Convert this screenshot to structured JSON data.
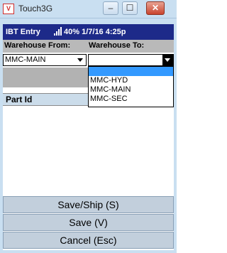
{
  "window": {
    "title": "Touch3G",
    "icon_text": "V",
    "minimize_symbol": "–",
    "maximize_symbol": "☐",
    "close_symbol": "✕"
  },
  "status": {
    "screen_name": "IBT Entry",
    "signal_icon": "signal-bars-icon",
    "battery": "40%",
    "date": "1/7/16",
    "time": "4:25p"
  },
  "form": {
    "warehouse_from_label": "Warehouse From:",
    "warehouse_to_label": "Warehouse To:",
    "warehouse_from_value": "MMC-MAIN",
    "warehouse_to_value": "",
    "warehouse_to_options": [
      "",
      "MMC-HYD",
      "MMC-MAIN",
      "MMC-SEC"
    ],
    "grid_header": "Part Id"
  },
  "buttons": {
    "ship": "Save/Ship (S)",
    "save": "Save (V)",
    "cancel": "Cancel (Esc)"
  },
  "colors": {
    "status_bar": "#1d2a89",
    "selection": "#3399ff",
    "button_bg": "#c2cfdc"
  }
}
